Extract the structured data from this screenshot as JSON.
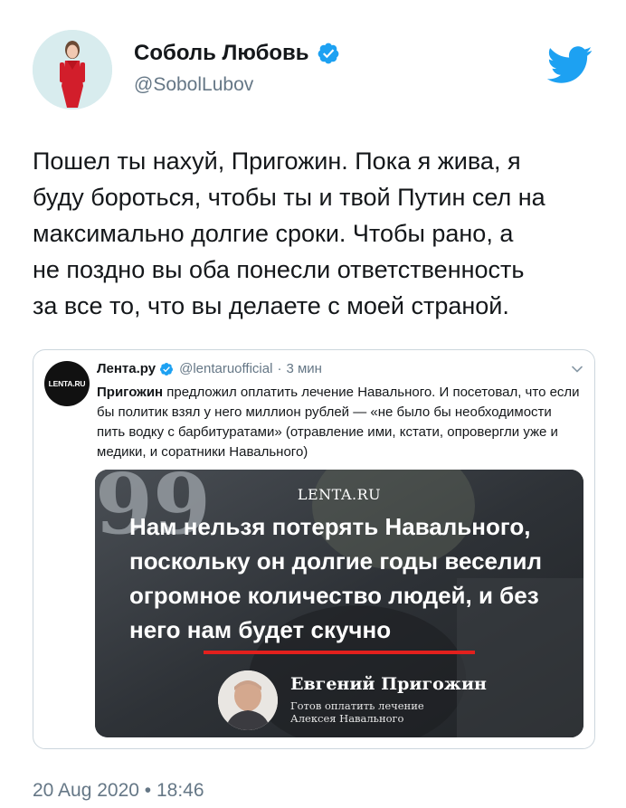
{
  "author": {
    "name": "Соболь Любовь",
    "handle": "@SobolLubov"
  },
  "tweet": {
    "text": "Пошел ты нахуй, Пригожин. Пока я жива, я\nбуду бороться, чтобы ты и твой Путин сел на\nмаксимально долгие сроки. Чтобы рано, а\nне поздно вы оба понесли ответственность\nза все то, что вы делаете с моей страной.",
    "timestamp": "20 Aug 2020 • 18:46"
  },
  "quoted": {
    "avatar_text": "LENTA.RU",
    "name": "Лента.ру",
    "handle": "@lentaruofficial",
    "separator": "·",
    "time": "3 мин",
    "text_bold": "Пригожин",
    "text_rest": " предложил оплатить лечение Навального. И посетовал, что если бы политик взял у него миллион рублей — «не было бы необходимости пить водку с барбитуратами» (отравление ими, кстати, опровергли уже и медики, и соратники Навального)",
    "image": {
      "logo": "LENTA.RU",
      "quote_mark": "99",
      "quote": "Нам нельзя потерять Навального, поскольку он долгие годы веселил огромное количество людей, и без него нам будет скучно",
      "author": "Евгений Пригожин",
      "caption": "Готов оплатить лечение\nАлексея Навального"
    }
  },
  "colors": {
    "twitter_blue": "#1da1f2",
    "text_primary": "#14171a",
    "text_secondary": "#657786",
    "border": "#ccd6dd",
    "accent_red": "#e2201d"
  },
  "icons": {
    "verified": "verified-badge-icon",
    "bird": "twitter-bird-icon",
    "chevron": "chevron-down-icon"
  }
}
